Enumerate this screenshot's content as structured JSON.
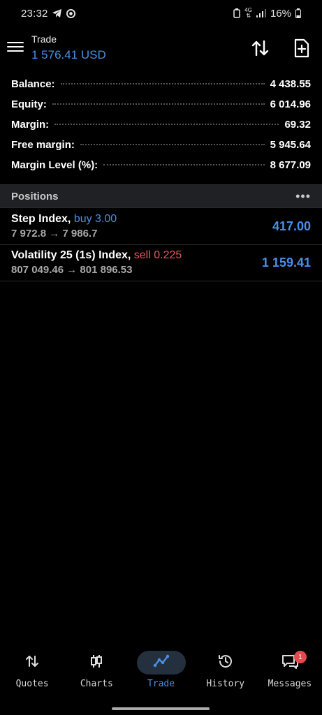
{
  "status_bar": {
    "time": "23:32",
    "network": "4G",
    "battery": "16%",
    "icons": [
      "telegram-icon",
      "chrome-icon",
      "battery-saver-icon",
      "signal-icon",
      "battery-icon"
    ]
  },
  "header": {
    "title": "Trade",
    "profit": "1 576.41 USD",
    "icons": [
      "menu-icon",
      "sort-icon",
      "new-order-icon"
    ]
  },
  "summary": [
    {
      "label": "Balance:",
      "value": "4 438.55"
    },
    {
      "label": "Equity:",
      "value": "6 014.96"
    },
    {
      "label": "Margin:",
      "value": "69.32"
    },
    {
      "label": "Free margin:",
      "value": "5 945.64"
    },
    {
      "label": "Margin Level (%):",
      "value": "8 677.09"
    }
  ],
  "positions": {
    "title": "Positions",
    "items": [
      {
        "symbol": "Step Index,",
        "side": "buy 3.00",
        "prices": "7 972.8 → 7 986.7",
        "profit": "417.00",
        "side_type": "buy"
      },
      {
        "symbol": "Volatility 25 (1s) Index,",
        "side": "sell 0.225",
        "prices": "807 049.46 → 801 896.53",
        "profit": "1 159.41",
        "side_type": "sell"
      }
    ]
  },
  "nav": {
    "items": [
      {
        "label": "Quotes",
        "icon": "quotes-icon"
      },
      {
        "label": "Charts",
        "icon": "charts-icon"
      },
      {
        "label": "Trade",
        "icon": "trade-icon",
        "active": true
      },
      {
        "label": "History",
        "icon": "history-icon"
      },
      {
        "label": "Messages",
        "icon": "messages-icon",
        "badge": "1"
      }
    ]
  },
  "colors": {
    "accent": "#4a8fe8",
    "sell": "#e85a5a",
    "background": "#000000",
    "section": "#202124"
  }
}
